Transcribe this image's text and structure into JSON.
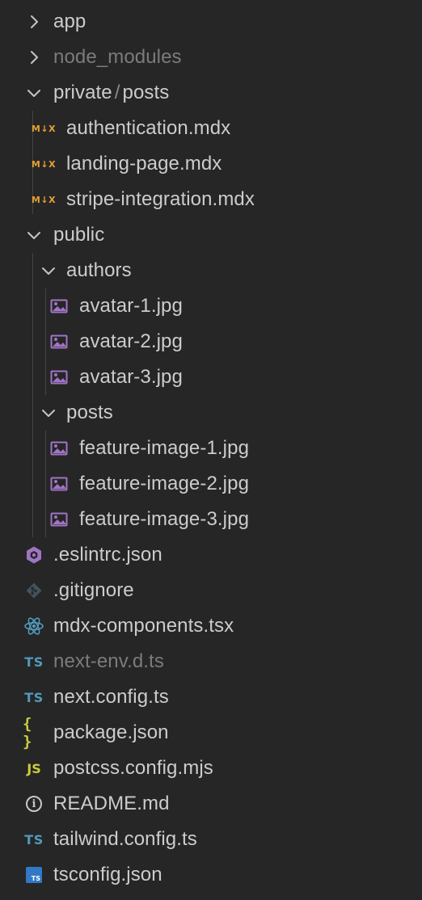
{
  "explorer": {
    "items": [
      {
        "label": "app",
        "type": "folder",
        "state": "collapsed",
        "level": 1,
        "icon": "chevron-right-icon"
      },
      {
        "label": "node_modules",
        "type": "folder",
        "state": "collapsed",
        "level": 1,
        "icon": "chevron-right-icon",
        "dimmed": true
      },
      {
        "label": "private",
        "separator": "/",
        "label2": "posts",
        "type": "folder",
        "state": "expanded",
        "level": 1,
        "icon": "chevron-down-icon"
      },
      {
        "label": "authentication.mdx",
        "type": "file",
        "level": 2,
        "icon": "mdx-file-icon"
      },
      {
        "label": "landing-page.mdx",
        "type": "file",
        "level": 2,
        "icon": "mdx-file-icon"
      },
      {
        "label": "stripe-integration.mdx",
        "type": "file",
        "level": 2,
        "icon": "mdx-file-icon"
      },
      {
        "label": "public",
        "type": "folder",
        "state": "expanded",
        "level": 1,
        "icon": "chevron-down-icon"
      },
      {
        "label": "authors",
        "type": "folder",
        "state": "expanded",
        "level": 2,
        "icon": "chevron-down-icon"
      },
      {
        "label": "avatar-1.jpg",
        "type": "file",
        "level": 3,
        "icon": "image-file-icon"
      },
      {
        "label": "avatar-2.jpg",
        "type": "file",
        "level": 3,
        "icon": "image-file-icon"
      },
      {
        "label": "avatar-3.jpg",
        "type": "file",
        "level": 3,
        "icon": "image-file-icon"
      },
      {
        "label": "posts",
        "type": "folder",
        "state": "expanded",
        "level": 2,
        "icon": "chevron-down-icon"
      },
      {
        "label": "feature-image-1.jpg",
        "type": "file",
        "level": 3,
        "icon": "image-file-icon"
      },
      {
        "label": "feature-image-2.jpg",
        "type": "file",
        "level": 3,
        "icon": "image-file-icon"
      },
      {
        "label": "feature-image-3.jpg",
        "type": "file",
        "level": 3,
        "icon": "image-file-icon"
      },
      {
        "label": ".eslintrc.json",
        "type": "file",
        "level": 1,
        "icon": "eslint-icon"
      },
      {
        "label": ".gitignore",
        "type": "file",
        "level": 1,
        "icon": "git-icon"
      },
      {
        "label": "mdx-components.tsx",
        "type": "file",
        "level": 1,
        "icon": "react-icon"
      },
      {
        "label": "next-env.d.ts",
        "type": "file",
        "level": 1,
        "icon": "typescript-icon",
        "dimmed": true
      },
      {
        "label": "next.config.ts",
        "type": "file",
        "level": 1,
        "icon": "typescript-icon"
      },
      {
        "label": "package.json",
        "type": "file",
        "level": 1,
        "icon": "json-icon"
      },
      {
        "label": "postcss.config.mjs",
        "type": "file",
        "level": 1,
        "icon": "javascript-icon"
      },
      {
        "label": "README.md",
        "type": "file",
        "level": 1,
        "icon": "info-icon"
      },
      {
        "label": "tailwind.config.ts",
        "type": "file",
        "level": 1,
        "icon": "typescript-icon"
      },
      {
        "label": "tsconfig.json",
        "type": "file",
        "level": 1,
        "icon": "tsconfig-icon"
      }
    ],
    "badges": {
      "mdx": "M↓X",
      "ts": "TS",
      "js": "JS",
      "json": "{ }",
      "tsconfig": "TS",
      "info": "i"
    },
    "colors": {
      "background": "#262626",
      "text": "#cccccc",
      "dimmed_text": "#7b7b7b",
      "indent_guide": "#444444",
      "chevron": "#c5c5c5",
      "typescript": "#519aba",
      "javascript": "#cbcb41",
      "json": "#cbcb41",
      "mdx": "#e5a035",
      "image": "#a074c4",
      "eslint": "#a074c4",
      "git": "#41535b",
      "react": "#519aba",
      "tsconfig": "#3178c6",
      "info": "#c8c8c8"
    }
  }
}
